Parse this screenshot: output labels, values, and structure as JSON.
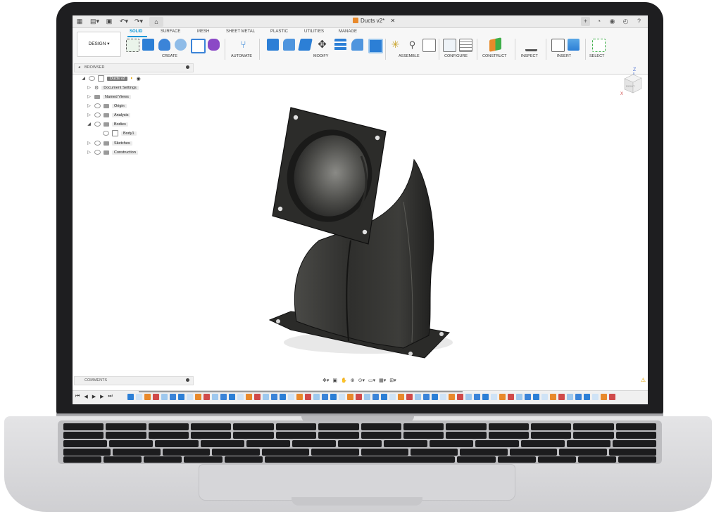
{
  "app": {
    "document_title": "Ducts v2*",
    "workspace": "DESIGN"
  },
  "ribbon": {
    "tabs": [
      {
        "label": "SOLID",
        "active": true
      },
      {
        "label": "SURFACE",
        "active": false
      },
      {
        "label": "MESH",
        "active": false
      },
      {
        "label": "SHEET METAL",
        "active": false
      },
      {
        "label": "PLASTIC",
        "active": false
      },
      {
        "label": "UTILITIES",
        "active": false
      },
      {
        "label": "MANAGE",
        "active": false
      }
    ],
    "groups": [
      "CREATE",
      "AUTOMATE",
      "MODIFY",
      "ASSEMBLE",
      "CONFIGURE",
      "CONSTRUCT",
      "INSPECT",
      "INSERT",
      "SELECT"
    ]
  },
  "browser": {
    "title": "BROWSER",
    "root": "Ducts v2",
    "items": [
      {
        "label": "Document Settings",
        "icon": "gear-icon"
      },
      {
        "label": "Named Views",
        "icon": "folder-icon"
      },
      {
        "label": "Origin",
        "icon": "folder-icon"
      },
      {
        "label": "Analysis",
        "icon": "folder-icon"
      },
      {
        "label": "Bodies",
        "icon": "folder-icon",
        "expanded": true
      },
      {
        "label": "Body1",
        "icon": "body-icon"
      },
      {
        "label": "Sketches",
        "icon": "folder-icon"
      },
      {
        "label": "Construction",
        "icon": "folder-icon"
      }
    ]
  },
  "viewcube": {
    "face_label": "RIGHT",
    "axis_z": "Z",
    "axis_x": "X"
  },
  "comments": {
    "title": "COMMENTS"
  },
  "colors": {
    "accent": "#0696d7",
    "model": "#3a3a38",
    "tab_active": "#0696d7"
  }
}
